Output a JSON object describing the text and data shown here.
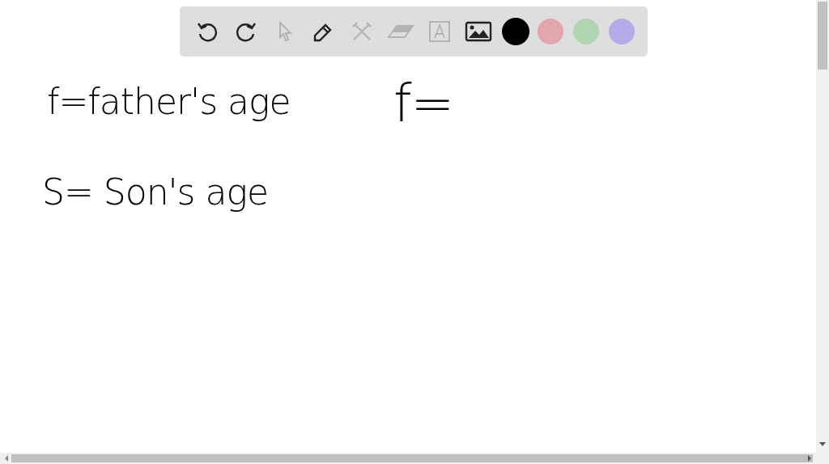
{
  "toolbar": {
    "tools": [
      {
        "kind": "undo",
        "disabled": false
      },
      {
        "kind": "redo",
        "disabled": false
      },
      {
        "kind": "pointer",
        "disabled": true
      },
      {
        "kind": "pen",
        "disabled": false
      },
      {
        "kind": "tools",
        "disabled": true
      },
      {
        "kind": "eraser",
        "disabled": true
      },
      {
        "kind": "text",
        "disabled": true
      },
      {
        "kind": "image",
        "disabled": false
      }
    ],
    "colors": [
      {
        "color": "#000000",
        "selected": true
      },
      {
        "color": "#e3a6ae",
        "selected": false
      },
      {
        "color": "#b1d5b1",
        "selected": false
      },
      {
        "color": "#b3ace8",
        "selected": false
      }
    ]
  },
  "notes": [
    {
      "text": "f=father's age"
    },
    {
      "text": "S= Son's age"
    },
    {
      "text": "f="
    }
  ]
}
